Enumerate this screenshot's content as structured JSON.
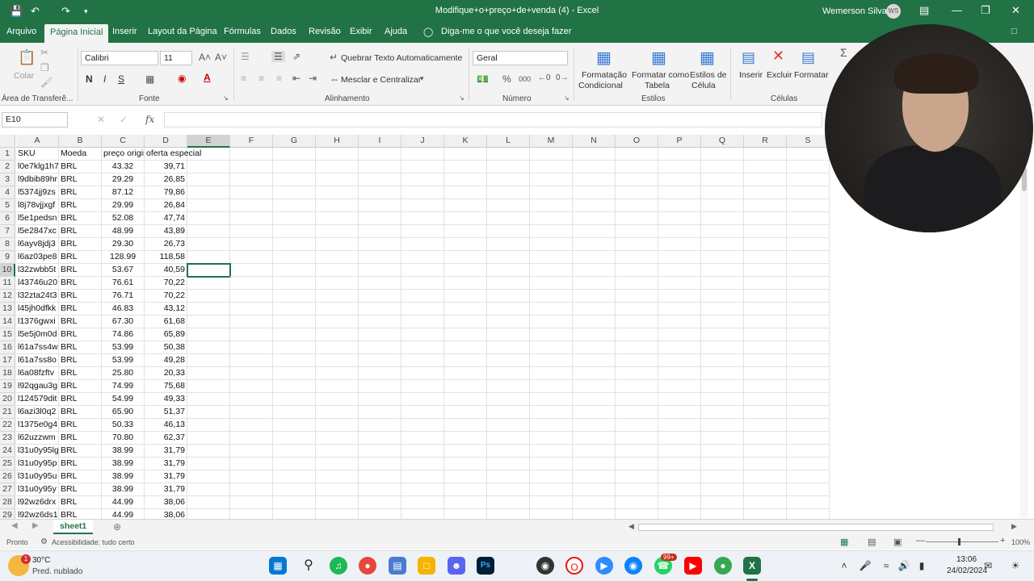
{
  "title_bar": {
    "doc_title": "Modifique+o+preço+de+venda (4)  -  Excel",
    "user_name": "Wemerson Silva",
    "user_initials": "WS",
    "save_icon": "save-icon",
    "undo_icon": "undo-icon",
    "redo_icon": "redo-icon"
  },
  "tabs": [
    "Arquivo",
    "Página Inicial",
    "Inserir",
    "Layout da Página",
    "Fórmulas",
    "Dados",
    "Revisão",
    "Exibir",
    "Ajuda"
  ],
  "tell_me": "Diga-me o que você deseja fazer",
  "ribbon": {
    "clipboard": {
      "paste": "Colar",
      "group": "Área de Transferê..."
    },
    "font": {
      "name": "Calibri",
      "size": "11",
      "bold": "N",
      "italic": "I",
      "underline": "S",
      "group": "Fonte"
    },
    "alignment": {
      "wrap": "Quebrar Texto Automaticamente",
      "merge": "Mesclar e Centralizar",
      "group": "Alinhamento"
    },
    "number": {
      "format": "Geral",
      "group": "Número"
    },
    "styles": {
      "cond": [
        "Formatação",
        "Condicional"
      ],
      "table": [
        "Formatar como",
        "Tabela"
      ],
      "cell": [
        "Estilos de",
        "Célula"
      ],
      "group": "Estilos"
    },
    "cells": {
      "insert": "Inserir",
      "delete": "Excluir",
      "format": "Formatar",
      "group": "Células"
    }
  },
  "formula_bar": {
    "name_box": "E10",
    "fx": "fx",
    "content": ""
  },
  "columns": [
    "A",
    "B",
    "C",
    "D",
    "E",
    "F",
    "G",
    "H",
    "I",
    "J",
    "K",
    "L",
    "M",
    "N",
    "O",
    "P",
    "Q",
    "R",
    "S"
  ],
  "rows": [
    {
      "n": "1",
      "a": "SKU",
      "b": "Moeda",
      "c": "preço original",
      "d": "oferta especial"
    },
    {
      "n": "2",
      "a": "l0e7klg1h7",
      "b": "BRL",
      "c": "43.32",
      "d": "39,71"
    },
    {
      "n": "3",
      "a": "l9dbib89hr",
      "b": "BRL",
      "c": "29.29",
      "d": "26,85"
    },
    {
      "n": "4",
      "a": "l5374jj9zs",
      "b": "BRL",
      "c": "87.12",
      "d": "79,86"
    },
    {
      "n": "5",
      "a": "l8j78vjjxgf",
      "b": "BRL",
      "c": "29.99",
      "d": "26,84"
    },
    {
      "n": "6",
      "a": "l5e1pedsn",
      "b": "BRL",
      "c": "52.08",
      "d": "47,74"
    },
    {
      "n": "7",
      "a": "l5e2847xc",
      "b": "BRL",
      "c": "48.99",
      "d": "43,89"
    },
    {
      "n": "8",
      "a": "l6ayv8jdj3",
      "b": "BRL",
      "c": "29.30",
      "d": "26,73"
    },
    {
      "n": "9",
      "a": "l6az03pe8",
      "b": "BRL",
      "c": "128.99",
      "d": "118,58"
    },
    {
      "n": "10",
      "a": "l32zwbb5t",
      "b": "BRL",
      "c": "53.67",
      "d": "40,59"
    },
    {
      "n": "11",
      "a": "l43746u20",
      "b": "BRL",
      "c": "76.61",
      "d": "70,22"
    },
    {
      "n": "12",
      "a": "l32zta24t3",
      "b": "BRL",
      "c": "76.71",
      "d": "70,22"
    },
    {
      "n": "13",
      "a": "l45jh0dfkk",
      "b": "BRL",
      "c": "46.83",
      "d": "43,12"
    },
    {
      "n": "14",
      "a": "l1376gwxi",
      "b": "BRL",
      "c": "67.30",
      "d": "61,68"
    },
    {
      "n": "15",
      "a": "l5e5j0m0d",
      "b": "BRL",
      "c": "74.86",
      "d": "65,89"
    },
    {
      "n": "16",
      "a": "l61a7ss4w",
      "b": "BRL",
      "c": "53.99",
      "d": "50,38"
    },
    {
      "n": "17",
      "a": "l61a7ss8o",
      "b": "BRL",
      "c": "53.99",
      "d": "49,28"
    },
    {
      "n": "18",
      "a": "l6a08fzftv",
      "b": "BRL",
      "c": "25.80",
      "d": "20,33"
    },
    {
      "n": "19",
      "a": "l92qgau3g",
      "b": "BRL",
      "c": "74.99",
      "d": "75,68"
    },
    {
      "n": "20",
      "a": "l124579dit",
      "b": "BRL",
      "c": "54.99",
      "d": "49,33"
    },
    {
      "n": "21",
      "a": "l6azi3l0q2",
      "b": "BRL",
      "c": "65.90",
      "d": "51,37"
    },
    {
      "n": "22",
      "a": "l1375e0g4",
      "b": "BRL",
      "c": "50.33",
      "d": "46,13"
    },
    {
      "n": "23",
      "a": "l62uzzwm",
      "b": "BRL",
      "c": "70.80",
      "d": "62,37"
    },
    {
      "n": "24",
      "a": "l31u0y95lg",
      "b": "BRL",
      "c": "38.99",
      "d": "31,79"
    },
    {
      "n": "25",
      "a": "l31u0y95p",
      "b": "BRL",
      "c": "38.99",
      "d": "31,79"
    },
    {
      "n": "26",
      "a": "l31u0y95u",
      "b": "BRL",
      "c": "38.99",
      "d": "31,79"
    },
    {
      "n": "27",
      "a": "l31u0y95y",
      "b": "BRL",
      "c": "38.99",
      "d": "31,79"
    },
    {
      "n": "28",
      "a": "l92wz6drx",
      "b": "BRL",
      "c": "44.99",
      "d": "38,06"
    },
    {
      "n": "29",
      "a": "l92wz6ds1",
      "b": "BRL",
      "c": "44.99",
      "d": "38,06"
    }
  ],
  "sheet_tab": "sheet1",
  "status": {
    "ready": "Pronto",
    "accessibility": "Acessibilidade: tudo certo",
    "zoom": "100%"
  },
  "taskbar": {
    "weather_temp": "30°C",
    "weather_desc": "Pred. nublado",
    "time": "13:06",
    "date": "24/02/2024",
    "badge": "99+"
  },
  "colors": {
    "excel_green": "#217346",
    "ribbon_bg": "#f3f3f3"
  }
}
